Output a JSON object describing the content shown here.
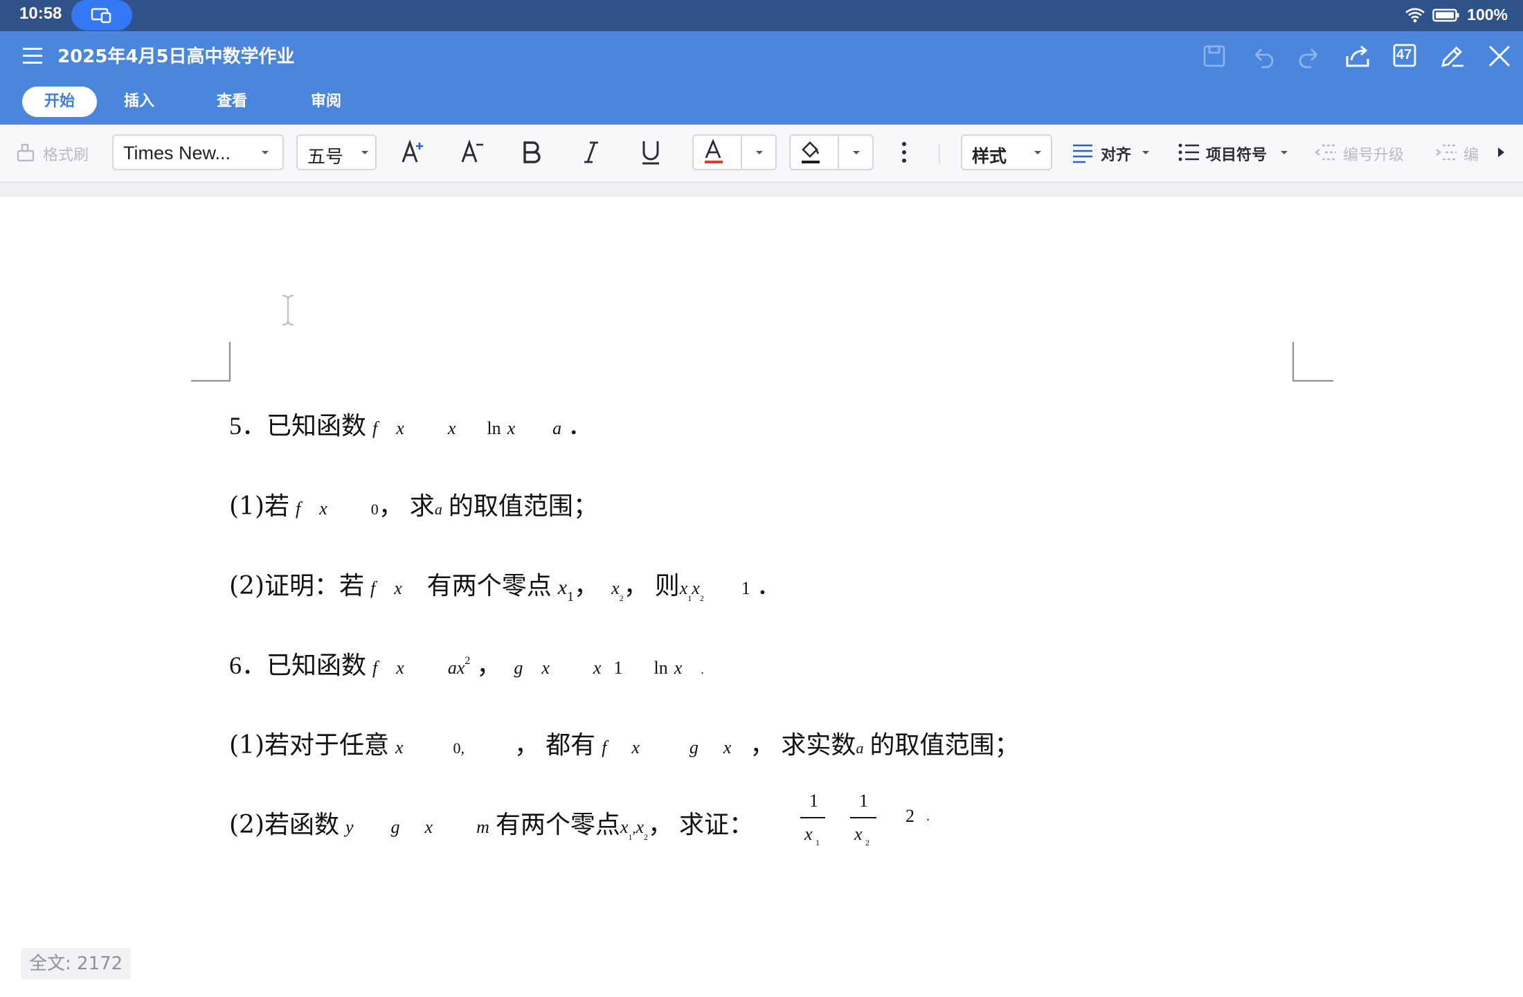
{
  "status_bar": {
    "time": "10:58",
    "battery": "100%",
    "icons": [
      "screen-mirror-icon",
      "wifi-icon",
      "battery-icon"
    ]
  },
  "title_bar": {
    "doc_title": "2025年4月5日高中数学作业",
    "page_badge": "47",
    "tabs": [
      {
        "label": "开始",
        "active": true
      },
      {
        "label": "插入",
        "active": false
      },
      {
        "label": "查看",
        "active": false
      },
      {
        "label": "审阅",
        "active": false
      }
    ],
    "actions": [
      "save-icon",
      "undo-icon",
      "redo-icon",
      "share-icon",
      "page-count-icon",
      "edit-pen-icon",
      "close-icon"
    ]
  },
  "toolbar": {
    "format_painter": "格式刷",
    "font_name": "Times New...",
    "font_size": "五号",
    "style": "样式",
    "align": "对齐",
    "bullets": "项目符号",
    "numbering_upgrade": "编号升级",
    "numbering_downgrade": "编"
  },
  "document": {
    "lines": {
      "q5": {
        "num": "5．",
        "cn": "已知函数",
        "f": "f",
        "x": "x",
        "x2": "x",
        "ln": "ln",
        "x3": "x",
        "a": "a",
        "end": "．"
      },
      "q5_1": {
        "pre": "(1)若",
        "f": "f",
        "x": "x",
        "zero": "0",
        "comma": "，",
        "qiu": "求",
        "a": "a",
        "post": "的取值范围；"
      },
      "q5_2": {
        "pre": "(2)证明：若",
        "f": "f",
        "x": "x",
        "mid": "有两个零点",
        "x1": "x",
        "s1": "1",
        "c1": "，",
        "x2": "x",
        "s2": "2",
        "c2": "，",
        "ze": "则",
        "px1": "x",
        "ps1": "1",
        "px2": "x",
        "ps2": "2",
        "one": "1",
        "end": "．"
      },
      "q6": {
        "num": "6．",
        "cn": "已知函数",
        "f": "f",
        "x": "x",
        "ax": "ax",
        "sq": "2",
        "c1": "，",
        "g": "g",
        "gx": "x",
        "x2": "x",
        "one": "1",
        "ln": "ln",
        "x3": "x",
        "end": "."
      },
      "q6_1": {
        "pre": "(1)若对于任意",
        "x": "x",
        "interval": "0,",
        "c1": "，",
        "mid": "都有",
        "f": "f",
        "fx": "x",
        "g": "g",
        "gx": "x",
        "c2": "，",
        "post": "求实数",
        "a": "a",
        "tail": "的取值范围；"
      },
      "q6_2": {
        "pre": "(2)若函数",
        "y": "y",
        "g": "g",
        "x": "x",
        "m": "m",
        "mid": "有两个零点",
        "x1": "x",
        "s1": "1",
        "sep": ",",
        "x2": "x",
        "s2": "2",
        "c1": "，",
        "post": "求证：",
        "n1": "1",
        "d1": "x",
        "ds1": "1",
        "n2": "1",
        "d2": "x",
        "ds2": "2",
        "two": "2",
        "end": "."
      }
    }
  },
  "footer": {
    "word_count": "全文: 2172"
  }
}
